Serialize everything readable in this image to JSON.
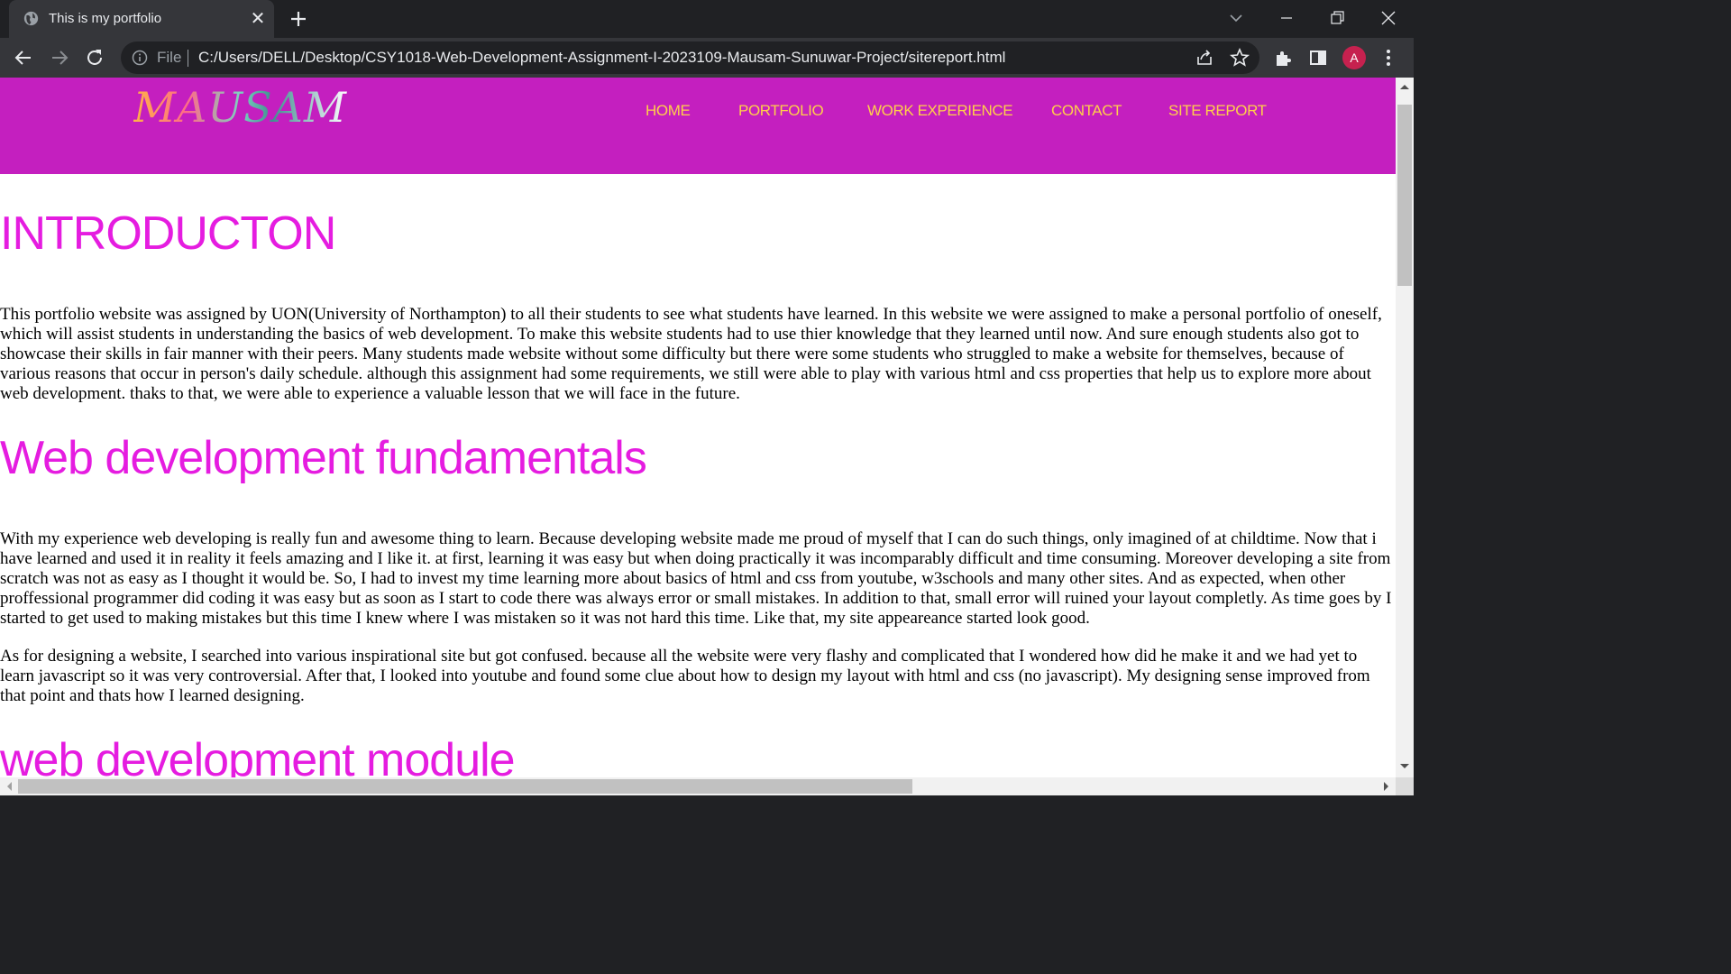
{
  "browser": {
    "tab": {
      "title": "This is my portfolio",
      "close": "✕"
    },
    "address": {
      "scheme_label": "File",
      "url": "C:/Users/DELL/Desktop/CSY1018-Web-Development-Assignment-I-2023109-Mausam-Sunuwar-Project/sitereport.html"
    },
    "profile_initial": "A",
    "accent_colors": {
      "chrome_dark": "#202124",
      "chrome_toolbar": "#35363a",
      "avatar": "#c6214f"
    }
  },
  "site": {
    "logo": "MAUSAM",
    "nav": [
      "HOME",
      "PORTFOLIO",
      "WORK EXPERIENCE",
      "CONTACT",
      "SITE REPORT"
    ],
    "colors": {
      "header_bg": "#c41fbf",
      "nav_text": "#ffcf4a",
      "heading": "#e51ce0"
    }
  },
  "content": {
    "sections": [
      {
        "heading": "INTRODUCTON",
        "paragraphs": [
          "This portfolio website was assigned by UON(University of Northampton) to all their students to see what students have learned. In this website we were assigned to make a personal portfolio of oneself, which will assist students in understanding the basics of web development. To make this website students had to use thier knowledge that they learned until now. And sure enough students also got to showcase their skills in fair manner with their peers. Many students made website without some difficulty but there were some students who struggled to make a website for themselves, because of various reasons that occur in person's daily schedule. although this assignment had some requirements, we still were able to play with various html and css properties that help us to explore more about web development. thaks to that, we were able to experience a valuable lesson that we will face in the future."
        ]
      },
      {
        "heading": "Web development fundamentals",
        "paragraphs": [
          "With my experience web developing is really fun and awesome thing to learn. Because developing website made me proud of myself that I can do such things, only imagined of at childtime. Now that i have learned and used it in reality it feels amazing and I like it. at first, learning it was easy but when doing practically it was incomparably difficult and time consuming. Moreover developing a site from scratch was not as easy as I thought it would be. So, I had to invest my time learning more about basics of html and css from youtube, w3schools and many other sites. And as expected, when other proffessional programmer did coding it was easy but as soon as I start to code there was always error or small mistakes. In addition to that, small error will ruined your layout completly. As time goes by I started to get used to making mistakes but this time I knew where I was mistaken so it was not hard this time. Like that, my site appeareance started look good.",
          "As for designing a website, I searched into various inspirational site but got confused. because all the website were very flashy and complicated that I wondered how did he make it and we had yet to learn javascript so it was very controversial. After that, I looked into youtube and found some clue about how to design my layout with html and css (no javascript). My designing sense improved from that point and thats how I learned designing."
        ]
      },
      {
        "heading": "web development module",
        "paragraphs": []
      }
    ]
  }
}
